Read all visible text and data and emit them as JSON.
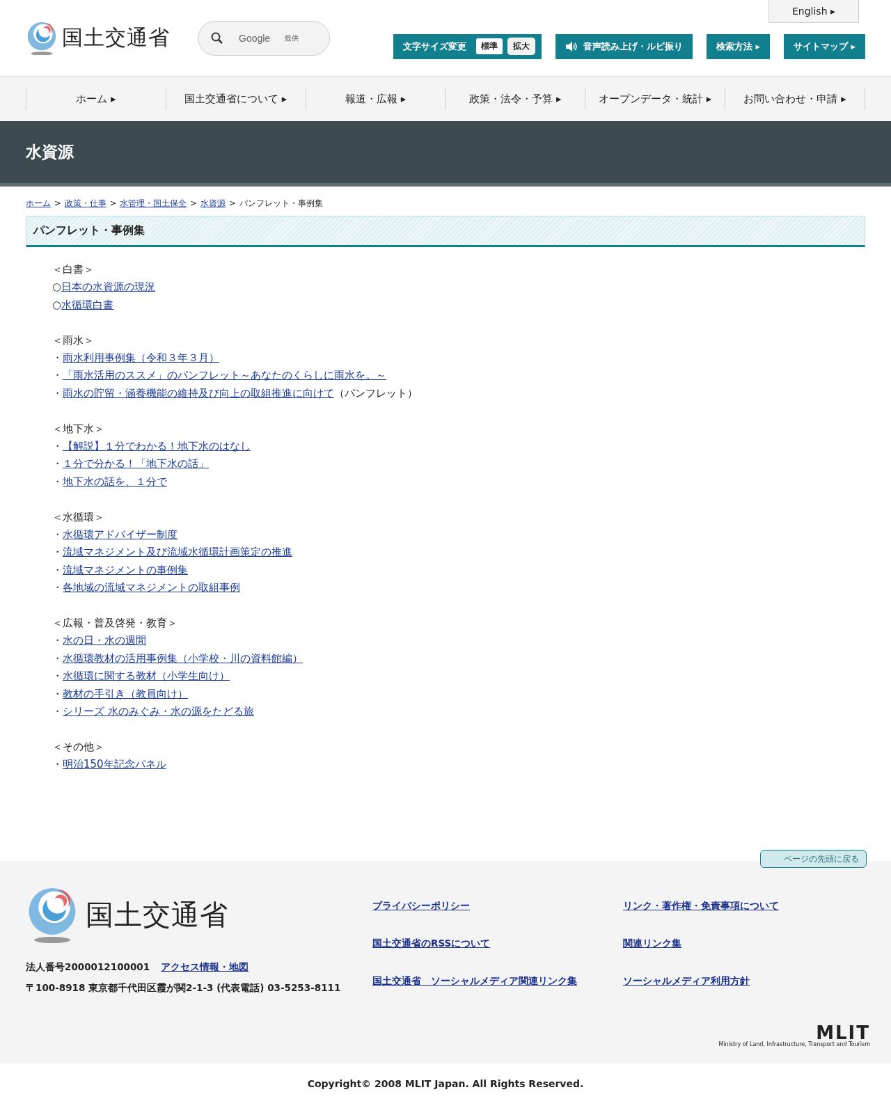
{
  "header": {
    "logo_text": "国土交通省",
    "language_link": "English ▸",
    "search": {
      "placeholder": "Google",
      "provider": "提供"
    },
    "font_size": {
      "label": "文字サイズ変更",
      "options": [
        {
          "label": "標準",
          "selected": true
        },
        {
          "label": "拡大",
          "selected": false
        }
      ]
    },
    "buttons": [
      {
        "kind": "speaker",
        "label": "音声読み上げ・ルビ振り"
      },
      {
        "kind": "arrow",
        "label": "検索方法 ▸"
      },
      {
        "kind": "arrow",
        "label": "サイトマップ ▸"
      }
    ]
  },
  "nav": [
    "ホーム ▸",
    "国土交通省について ▸",
    "報道・広報 ▸",
    "政策・法令・予算 ▸",
    "オープンデータ・統計 ▸",
    "お問い合わせ・申請 ▸"
  ],
  "banner_title": "水資源",
  "breadcrumb": {
    "links": [
      "ホーム",
      "政策・仕事",
      "水管理・国土保全",
      "水資源"
    ],
    "separator": ">",
    "current": "パンフレット・事例集"
  },
  "section_title": "パンフレット・事例集",
  "groups": [
    {
      "heading": "＜白書＞",
      "items": [
        {
          "marker": "○",
          "link": "日本の水資源の現況"
        },
        {
          "marker": "○",
          "link": "水循環白書"
        }
      ]
    },
    {
      "heading": "＜雨水＞",
      "items": [
        {
          "marker": "・",
          "link": "雨水利用事例集（令和３年３月）"
        },
        {
          "marker": "・",
          "link": "「雨水活用のススメ」のパンフレット～あなたのくらしに雨水を。～"
        },
        {
          "marker": "・",
          "link": "雨水の貯留・涵養機能の維持及び向上の取組推進に向けて",
          "note": "（パンフレット）"
        }
      ]
    },
    {
      "heading": "＜地下水＞",
      "items": [
        {
          "marker": "・",
          "link": "【解説】１分でわかる！地下水のはなし"
        },
        {
          "marker": "・",
          "link": "１分で分かる！「地下水の話」"
        },
        {
          "marker": "・",
          "link": "地下水の話を、１分で"
        }
      ]
    },
    {
      "heading": "＜水循環＞",
      "items": [
        {
          "marker": "・",
          "link": "水循環アドバイザー制度"
        },
        {
          "marker": "・",
          "link": "流域マネジメント及び流域水循環計画策定の推進"
        },
        {
          "marker": "・",
          "link": "流域マネジメントの事例集"
        },
        {
          "marker": "・",
          "link": "各地域の流域マネジメントの取組事例"
        }
      ]
    },
    {
      "heading": "＜広報・普及啓発・教育＞",
      "items": [
        {
          "marker": "・",
          "link": "水の日・水の週間"
        },
        {
          "marker": "・",
          "link": "水循環教材の活用事例集（小学校・川の資料館編）"
        },
        {
          "marker": "・",
          "link": "水循環に関する教材（小学生向け）"
        },
        {
          "marker": "・",
          "link": "教材の手引き（教員向け）"
        },
        {
          "marker": "・",
          "link": "シリーズ 水のみぐみ・水の源をたどる旅"
        }
      ]
    },
    {
      "heading": "＜その他＞",
      "items": [
        {
          "marker": "・",
          "link": "明治150年記念パネル"
        }
      ]
    }
  ],
  "page_top": "ページの先頭に戻る",
  "footer": {
    "logo_text": "国土交通省",
    "corporate_number": "法人番号2000012100001",
    "access_link": "アクセス情報・地図",
    "address": "〒100-8918 東京都千代田区霞が関2-1-3 (代表電話) 03-5253-8111",
    "links": [
      "プライバシーポリシー",
      "リンク・著作権・免責事項について",
      "国土交通省のRSSについて",
      "関連リンク集",
      "国土交通省　ソーシャルメディア関連リンク集",
      "ソーシャルメディア利用方針"
    ],
    "mlit": "MLIT",
    "mlit_sub": "Ministry of Land, Infrastructure, Transport and Tourism"
  },
  "copyright": "Copyright© 2008 MLIT Japan. All Rights Reserved."
}
